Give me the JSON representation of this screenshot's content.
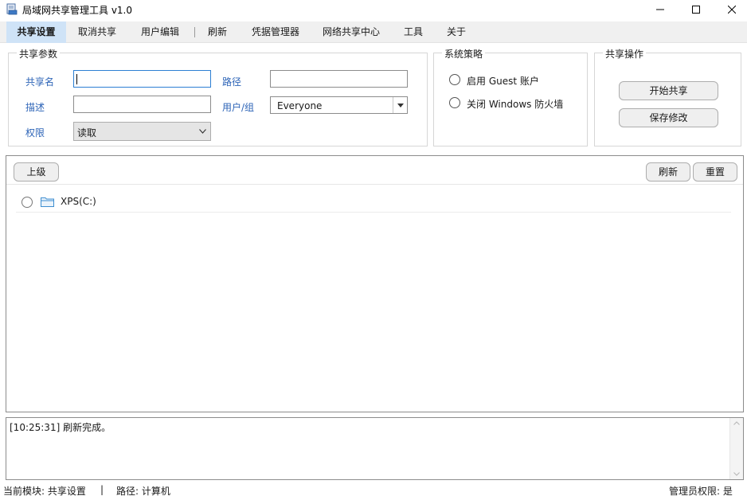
{
  "window": {
    "title": "局域网共享管理工具 v1.0"
  },
  "tabs": [
    {
      "label": "共享设置",
      "active": true
    },
    {
      "label": "取消共享"
    },
    {
      "label": "用户编辑"
    },
    {
      "label": "刷新"
    },
    {
      "label": "凭据管理器"
    },
    {
      "label": "网络共享中心"
    },
    {
      "label": "工具"
    },
    {
      "label": "关于"
    }
  ],
  "share_params": {
    "title": "共享参数",
    "share_name_label": "共享名",
    "share_name_value": "",
    "path_label": "路径",
    "path_value": "",
    "desc_label": "描述",
    "desc_value": "",
    "user_group_label": "用户/组",
    "user_group_value": "Everyone",
    "permission_label": "权限",
    "permission_value": "读取"
  },
  "policy": {
    "title": "系统策略",
    "enable_guest": "启用 Guest 账户",
    "disable_firewall": "关闭 Windows 防火墙"
  },
  "share_ops": {
    "title": "共享操作",
    "start_share": "开始共享",
    "save_changes": "保存修改"
  },
  "browser": {
    "up_label": "上级",
    "refresh_label": "刷新",
    "reset_label": "重置",
    "items": [
      {
        "name": "XPS(C:)"
      }
    ]
  },
  "log": {
    "lines": [
      "[10:25:31] 刷新完成。"
    ]
  },
  "status": {
    "module": "当前模块: 共享设置",
    "separator": "|",
    "path": "路径: 计算机",
    "admin": "管理员权限: 是"
  },
  "colors": {
    "accent_label": "#2d64b7",
    "active_tab": "#cfe3f7",
    "folder": "#3e8ed0"
  }
}
